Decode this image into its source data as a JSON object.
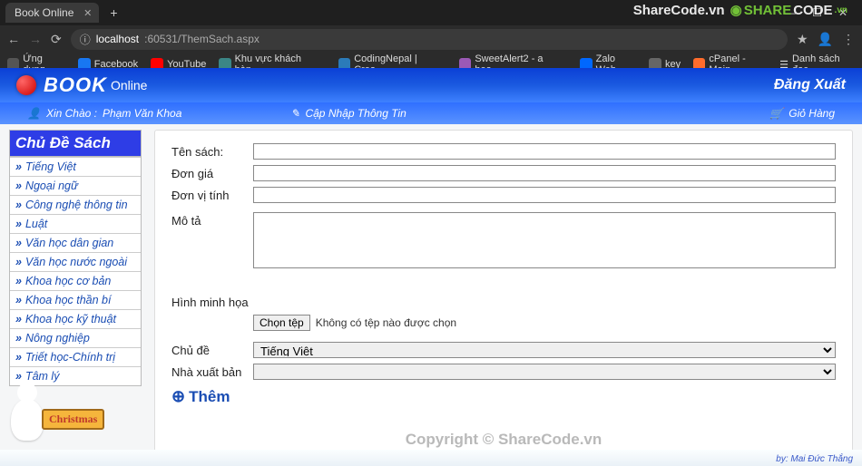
{
  "browser": {
    "tab_title": "Book Online",
    "url_host": "localhost",
    "url_path": ":60531/ThemSach.aspx",
    "apps_label": "Ứng dụng",
    "bookmarks": [
      "Facebook",
      "YouTube",
      "Khu vực khách hàn…",
      "CodingNepal | Crea…",
      "SweetAlert2 - a bea…",
      "Zalo Web",
      "key",
      "cPanel - Main"
    ],
    "reading_list": "Danh sách đọc"
  },
  "header": {
    "logo_main": "BOOK",
    "logo_sub": "Online",
    "logout": "Đăng Xuất"
  },
  "userbar": {
    "greet_prefix": "Xin Chào :",
    "greet_name": "Phạm Văn Khoa",
    "update_info": "Cập Nhập Thông Tin",
    "cart": "Giỏ Hàng"
  },
  "sidebar": {
    "title": "Chủ Đề Sách",
    "items": [
      "Tiếng Việt",
      "Ngoại ngữ",
      "Công nghệ thông tin",
      "Luật",
      "Văn học dân gian",
      "Văn học nước ngoài",
      "Khoa học cơ bản",
      "Khoa học thần bí",
      "Khoa học kỹ thuật",
      "Nông nghiệp",
      "Triết học-Chính trị",
      "Tâm lý"
    ]
  },
  "form": {
    "labels": {
      "name": "Tên sách:",
      "price": "Đơn giá",
      "unit": "Đơn vị tính",
      "desc": "Mô tả",
      "image": "Hình minh họa",
      "topic": "Chủ đề",
      "publisher": "Nhà xuất bản"
    },
    "file_btn": "Chọn tệp",
    "file_none": "Không có tệp nào được chọn",
    "topic_selected": "Tiếng Việt",
    "publisher_selected": "",
    "add_label": "Thêm"
  },
  "watermark": {
    "top_text": "ShareCode.vn",
    "top_logo": "SHARECODE.vn",
    "mid": "Copyright © ShareCode.vn",
    "credit": "by: Mai Đức Thắng"
  },
  "xmas": {
    "sign": "Christmas"
  }
}
